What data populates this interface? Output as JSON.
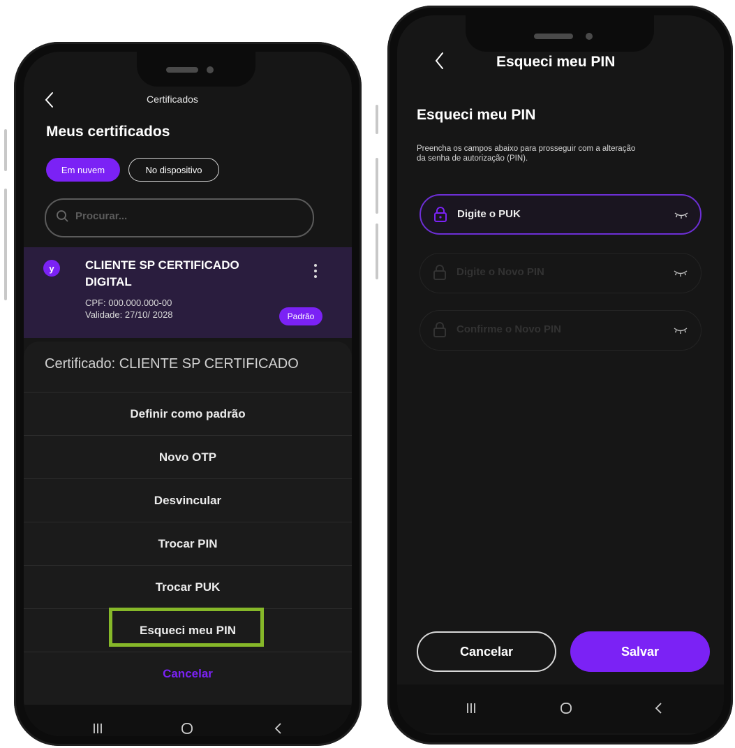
{
  "left_phone": {
    "header_title": "Certificados",
    "page_title": "Meus certificados",
    "chips": {
      "cloud_label": "Em nuvem",
      "device_label": "No dispositivo"
    },
    "search": {
      "placeholder": "Procurar..."
    },
    "certificate": {
      "avatar_text": "y",
      "name_line1": "CLIENTE SP CERTIFICADO",
      "name_line2": "DIGITAL",
      "cpf": "CPF: 000.000.000-00",
      "validity": "Validade: 27/10/ 2028",
      "badge": "Padrão"
    },
    "sheet": {
      "title": "Certificado:  CLIENTE SP CERTIFICADO",
      "items": [
        "Definir como padrão",
        "Novo OTP",
        "Desvincular",
        "Trocar PIN",
        "Trocar PUK",
        "Esqueci meu PIN"
      ],
      "cancel_label": "Cancelar"
    }
  },
  "right_phone": {
    "header_title": "Esqueci meu PIN",
    "page_title": "Esqueci meu PIN",
    "description": [
      "Preencha os campos abaixo para prosseguir com a alteração",
      "da senha de autorização (PIN)."
    ],
    "fields": [
      {
        "placeholder": "Digite o PUK",
        "state": "active"
      },
      {
        "placeholder": "Digite o Novo PIN",
        "state": "disabled"
      },
      {
        "placeholder": "Confirme o Novo PIN",
        "state": "disabled"
      }
    ],
    "buttons": {
      "cancel_label": "Cancelar",
      "save_label": "Salvar"
    }
  },
  "colors": {
    "accent_purple": "#7b22f5",
    "highlight_green": "#86b829",
    "screen_bg": "#161616",
    "card_bg": "#2a1d3e"
  },
  "icons": [
    "back-icon",
    "search-icon",
    "more-icon",
    "lock-icon",
    "eye-closed-icon",
    "recent-apps-icon",
    "home-icon",
    "nav-back-icon"
  ]
}
